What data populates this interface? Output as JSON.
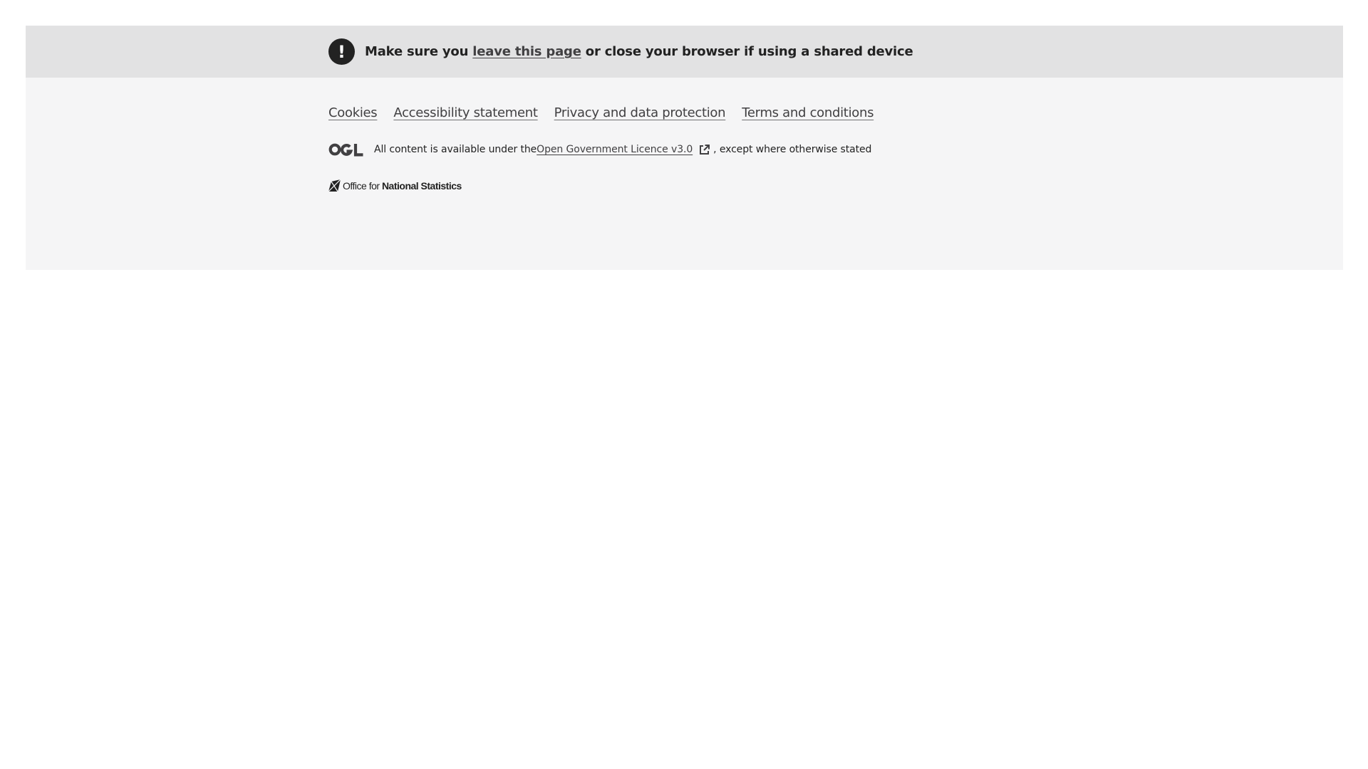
{
  "warning": {
    "icon": "exclamation-icon",
    "icon_glyph": "!",
    "text_before": "Make sure you ",
    "link_label": "leave this page",
    "text_after": " or close your browser if using a shared device"
  },
  "footer": {
    "links": [
      {
        "label": "Cookies"
      },
      {
        "label": "Accessibility statement"
      },
      {
        "label": "Privacy and data protection"
      },
      {
        "label": "Terms and conditions"
      }
    ],
    "licence": {
      "logo": "ogl-logo",
      "text_before": "All content is available under the ",
      "link_label": "Open Government Licence v3.0",
      "link_icon": "external-link-icon",
      "text_after": ", except where otherwise stated"
    },
    "organisation": {
      "logo": "ons-logo",
      "name_regular": "Office for ",
      "name_bold": "National Statistics"
    }
  },
  "colors": {
    "footer_background": "#f5f5f6",
    "warning_background": "#e2e2e3",
    "text": "#222222",
    "link": "#414042"
  }
}
